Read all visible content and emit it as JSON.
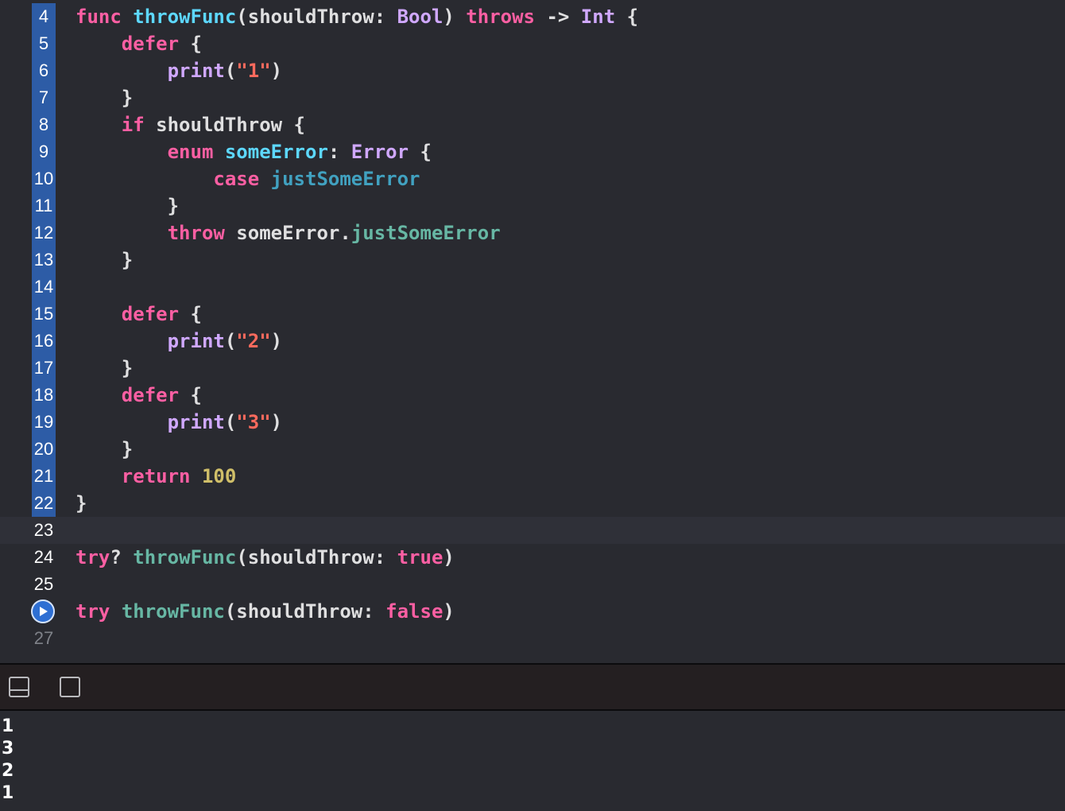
{
  "editor": {
    "lines": [
      {
        "num": "4",
        "tokens": [
          {
            "t": "func",
            "c": "kw"
          },
          {
            "t": " ",
            "c": "pl"
          },
          {
            "t": "throwFunc",
            "c": "fn-decl"
          },
          {
            "t": "(shouldThrow: ",
            "c": "pl"
          },
          {
            "t": "Bool",
            "c": "tp"
          },
          {
            "t": ") ",
            "c": "pl"
          },
          {
            "t": "throws",
            "c": "kw"
          },
          {
            "t": " -> ",
            "c": "pl"
          },
          {
            "t": "Int",
            "c": "tp"
          },
          {
            "t": " {",
            "c": "pl"
          }
        ]
      },
      {
        "num": "5",
        "tokens": [
          {
            "t": "    ",
            "c": "pl"
          },
          {
            "t": "defer",
            "c": "kw"
          },
          {
            "t": " {",
            "c": "pl"
          }
        ]
      },
      {
        "num": "6",
        "tokens": [
          {
            "t": "        ",
            "c": "pl"
          },
          {
            "t": "print",
            "c": "tp"
          },
          {
            "t": "(",
            "c": "pl"
          },
          {
            "t": "\"1\"",
            "c": "str"
          },
          {
            "t": ")",
            "c": "pl"
          }
        ]
      },
      {
        "num": "7",
        "tokens": [
          {
            "t": "    }",
            "c": "pl"
          }
        ]
      },
      {
        "num": "8",
        "tokens": [
          {
            "t": "    ",
            "c": "pl"
          },
          {
            "t": "if",
            "c": "kw"
          },
          {
            "t": " shouldThrow {",
            "c": "pl"
          }
        ]
      },
      {
        "num": "9",
        "tokens": [
          {
            "t": "        ",
            "c": "pl"
          },
          {
            "t": "enum",
            "c": "kw"
          },
          {
            "t": " ",
            "c": "pl"
          },
          {
            "t": "someError",
            "c": "fn-decl"
          },
          {
            "t": ": ",
            "c": "pl"
          },
          {
            "t": "Error",
            "c": "tp"
          },
          {
            "t": " {",
            "c": "pl"
          }
        ]
      },
      {
        "num": "10",
        "tokens": [
          {
            "t": "            ",
            "c": "pl"
          },
          {
            "t": "case",
            "c": "kw"
          },
          {
            "t": " ",
            "c": "pl"
          },
          {
            "t": "justSomeError",
            "c": "enum-case"
          }
        ]
      },
      {
        "num": "11",
        "tokens": [
          {
            "t": "        }",
            "c": "pl"
          }
        ]
      },
      {
        "num": "12",
        "tokens": [
          {
            "t": "        ",
            "c": "pl"
          },
          {
            "t": "throw",
            "c": "kw"
          },
          {
            "t": " someError.",
            "c": "pl"
          },
          {
            "t": "justSomeError",
            "c": "call"
          }
        ]
      },
      {
        "num": "13",
        "tokens": [
          {
            "t": "    }",
            "c": "pl"
          }
        ]
      },
      {
        "num": "14",
        "tokens": []
      },
      {
        "num": "15",
        "tokens": [
          {
            "t": "    ",
            "c": "pl"
          },
          {
            "t": "defer",
            "c": "kw"
          },
          {
            "t": " {",
            "c": "pl"
          }
        ]
      },
      {
        "num": "16",
        "tokens": [
          {
            "t": "        ",
            "c": "pl"
          },
          {
            "t": "print",
            "c": "tp"
          },
          {
            "t": "(",
            "c": "pl"
          },
          {
            "t": "\"2\"",
            "c": "str"
          },
          {
            "t": ")",
            "c": "pl"
          }
        ]
      },
      {
        "num": "17",
        "tokens": [
          {
            "t": "    }",
            "c": "pl"
          }
        ]
      },
      {
        "num": "18",
        "tokens": [
          {
            "t": "    ",
            "c": "pl"
          },
          {
            "t": "defer",
            "c": "kw"
          },
          {
            "t": " {",
            "c": "pl"
          }
        ]
      },
      {
        "num": "19",
        "tokens": [
          {
            "t": "        ",
            "c": "pl"
          },
          {
            "t": "print",
            "c": "tp"
          },
          {
            "t": "(",
            "c": "pl"
          },
          {
            "t": "\"3\"",
            "c": "str"
          },
          {
            "t": ")",
            "c": "pl"
          }
        ]
      },
      {
        "num": "20",
        "tokens": [
          {
            "t": "    }",
            "c": "pl"
          }
        ]
      },
      {
        "num": "21",
        "tokens": [
          {
            "t": "    ",
            "c": "pl"
          },
          {
            "t": "return",
            "c": "kw"
          },
          {
            "t": " ",
            "c": "pl"
          },
          {
            "t": "100",
            "c": "num"
          }
        ]
      },
      {
        "num": "22",
        "tokens": [
          {
            "t": "}",
            "c": "pl"
          }
        ]
      },
      {
        "num": "23",
        "tokens": [],
        "current": true
      },
      {
        "num": "24",
        "tokens": [
          {
            "t": "try",
            "c": "kw"
          },
          {
            "t": "? ",
            "c": "pl"
          },
          {
            "t": "throwFunc",
            "c": "call"
          },
          {
            "t": "(shouldThrow: ",
            "c": "pl"
          },
          {
            "t": "true",
            "c": "kw"
          },
          {
            "t": ")",
            "c": "pl"
          }
        ]
      },
      {
        "num": "25",
        "tokens": []
      },
      {
        "num": "",
        "tokens": [
          {
            "t": "try",
            "c": "kw"
          },
          {
            "t": " ",
            "c": "pl"
          },
          {
            "t": "throwFunc",
            "c": "call"
          },
          {
            "t": "(shouldThrow: ",
            "c": "pl"
          },
          {
            "t": "false",
            "c": "kw"
          },
          {
            "t": ")",
            "c": "pl"
          }
        ],
        "run_marker": true
      },
      {
        "num": "27",
        "tokens": [],
        "dim": true
      }
    ]
  },
  "debug_bar": {
    "hide_console_icon": "panel-bottom-icon",
    "show_panel_icon": "panel-square-icon"
  },
  "console": {
    "output": [
      "1",
      "3",
      "2",
      "1"
    ]
  },
  "colors": {
    "background": "#292a30",
    "keyword": "#fc5fa3",
    "declaration": "#5dd8ff",
    "type": "#d0a8ff",
    "call": "#67b7a4",
    "string": "#fc6a5d",
    "number": "#d0bf69",
    "gutter_highlight": "#2d5ca6"
  }
}
